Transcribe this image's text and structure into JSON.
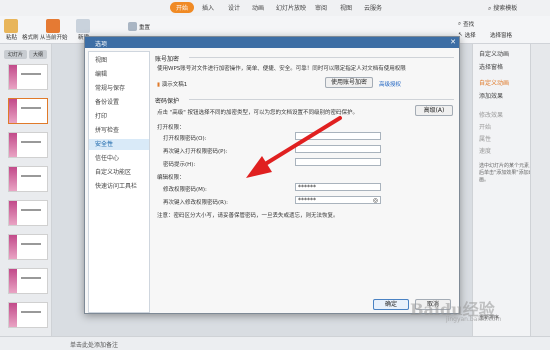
{
  "menubar": {
    "items": [
      "开始",
      "插入",
      "设计",
      "动画",
      "幻灯片放映",
      "审阅",
      "视图",
      "云服务"
    ],
    "active": "开始",
    "search": "搜索模板"
  },
  "ribbon": {
    "paste": "粘贴",
    "format_painter": "格式刷",
    "from_current": "从当前开始",
    "new_slide": "新建",
    "reset": "重置",
    "find": "查找",
    "select": "选择",
    "select_pane": "选择窗格"
  },
  "slidepane": {
    "tabs": [
      "幻灯片",
      "大纲"
    ]
  },
  "taskpane": {
    "title": "自定义动画",
    "select_pane": "选择窗格",
    "custom_animation": "自定义动画",
    "add_effect": "添加效果",
    "modify": "修改效果",
    "start": "开始",
    "property": "属性",
    "speed": "速度",
    "hint": "选中幻灯片的某个元素，然后单击\"添加效果\"添加动画。",
    "reorder": "重新排序"
  },
  "statusbar": {
    "note": "单击此处添加备注"
  },
  "dialog": {
    "title": "选项",
    "nav": [
      "视图",
      "编辑",
      "常规与保存",
      "备份设置",
      "打印",
      "拼写检查",
      "安全性",
      "信任中心",
      "自定义功能区",
      "快速访问工具栏"
    ],
    "selected_nav": "安全性",
    "account_section": "账号加密",
    "account_desc": "使用WPS账号对文件进行加密操作，简单、便捷、安全。可靠！同时可以限定指定人对文档有使用权限",
    "account_file": "演示文稿1",
    "account_button": "使用账号加密",
    "account_link": "高级授权",
    "password_section": "密码保护",
    "password_desc": "点击 \"高级\" 按钮选择不同的加密类型，可以为您的文档设置不同级别的密码保护。",
    "advanced_button": "高级(A)",
    "open_permission": "打开权限：",
    "open_password_label": "打开权限密码(O):",
    "open_password_confirm_label": "再次键入打开权限密码(P):",
    "open_hint_label": "密码提示(H):",
    "edit_permission": "编辑权限：",
    "edit_password_label": "修改权限密码(M):",
    "edit_password_value": "******",
    "edit_password_confirm_label": "再次键入修改权限密码(R):",
    "edit_password_confirm_value": "******",
    "note": "注意：密码区分大小写，请妥善保管密码，一旦丢失或遗忘，则无法恢复。",
    "ok_button": "确定",
    "cancel_button": "取消"
  },
  "watermark": {
    "brand": "Baidu经验",
    "url": "jingyan.baidu.com"
  }
}
